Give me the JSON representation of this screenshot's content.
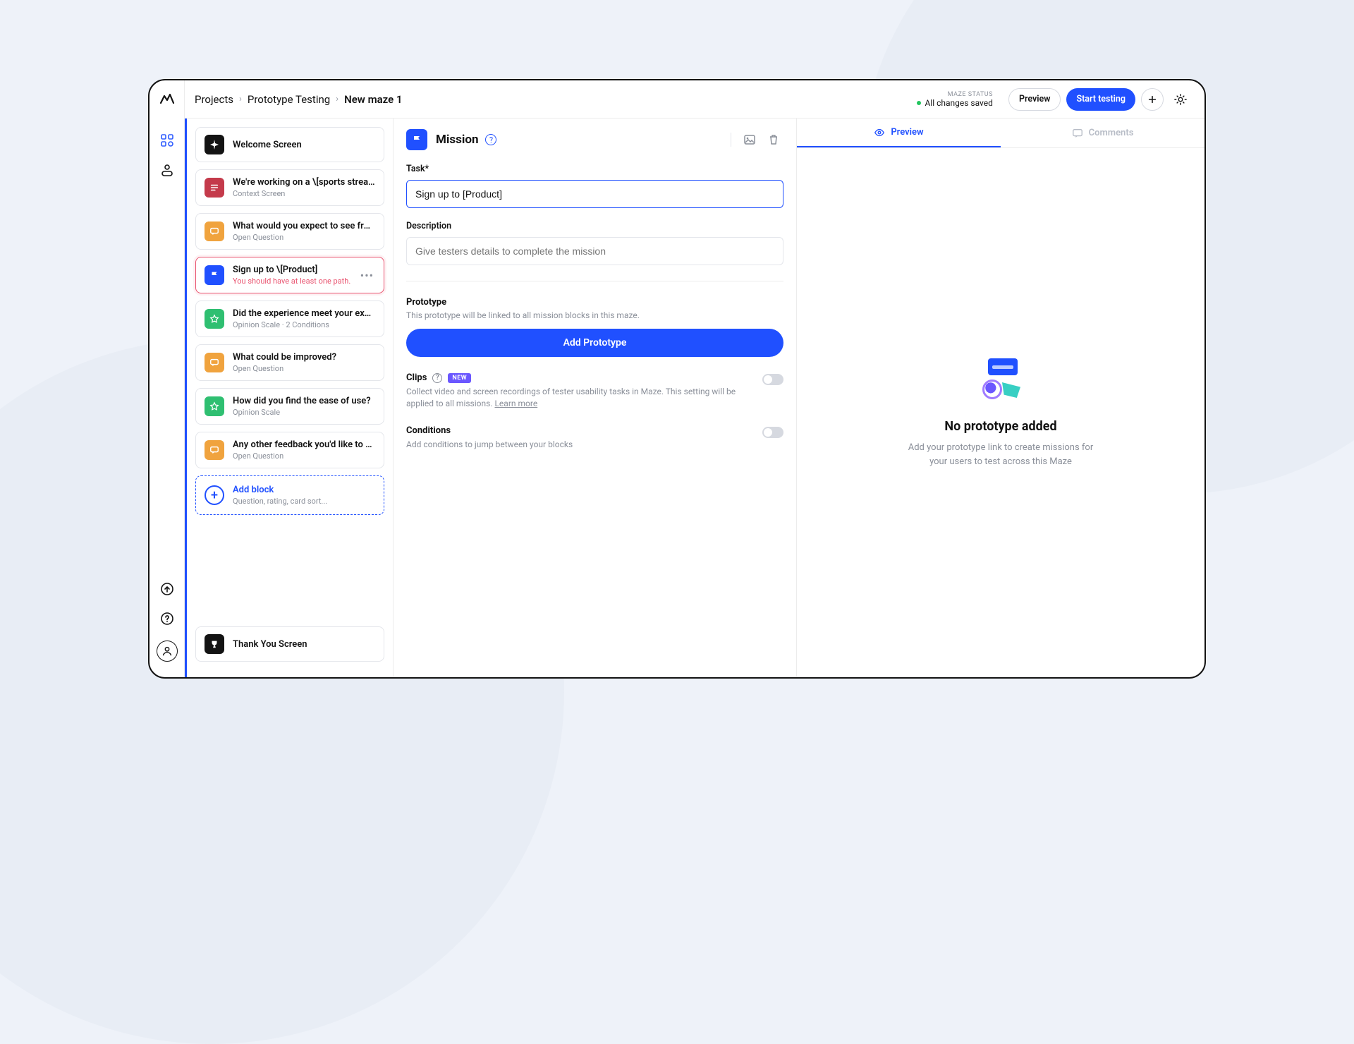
{
  "breadcrumb": {
    "projects": "Projects",
    "prototype_testing": "Prototype Testing",
    "current": "New maze 1"
  },
  "topbar": {
    "status_label": "MAZE STATUS",
    "status_text": "All changes saved",
    "preview": "Preview",
    "start_testing": "Start testing"
  },
  "blocks": {
    "welcome": {
      "title": "Welcome Screen"
    },
    "context": {
      "title": "We're working on a \\[sports strea...",
      "subtitle": "Context Screen"
    },
    "openq1": {
      "title": "What would you expect to see fro...",
      "subtitle": "Open Question"
    },
    "mission": {
      "title": "Sign up to \\[Product]",
      "subtitle": "You should have at least one path."
    },
    "opinion1": {
      "title": "Did the experience meet your exp...",
      "subtitle": "Opinion Scale · 2 Conditions"
    },
    "openq2": {
      "title": "What could be improved?",
      "subtitle": "Open Question"
    },
    "opinion2": {
      "title": "How did you find the ease of use?",
      "subtitle": "Opinion Scale"
    },
    "openq3": {
      "title": "Any other feedback you'd like to a...",
      "subtitle": "Open Question"
    },
    "add": {
      "title": "Add block",
      "subtitle": "Question, rating, card sort..."
    },
    "thankyou": {
      "title": "Thank You Screen"
    }
  },
  "editor": {
    "header_title": "Mission",
    "task_label": "Task*",
    "task_value": "Sign up to [Product]",
    "desc_label": "Description",
    "desc_placeholder": "Give testers details to complete the mission",
    "proto_label": "Prototype",
    "proto_desc": "This prototype will be linked to all mission blocks in this maze.",
    "add_proto_btn": "Add Prototype",
    "clips_label": "Clips",
    "clips_badge": "NEW",
    "clips_desc": "Collect video and screen recordings of tester usability tasks in Maze. This setting will be applied to all missions. ",
    "clips_learn": "Learn more",
    "cond_label": "Conditions",
    "cond_desc": "Add conditions to jump between your blocks"
  },
  "preview": {
    "tab_preview": "Preview",
    "tab_comments": "Comments",
    "empty_title": "No prototype added",
    "empty_desc": "Add your prototype link to create missions for your users to test across this Maze"
  }
}
